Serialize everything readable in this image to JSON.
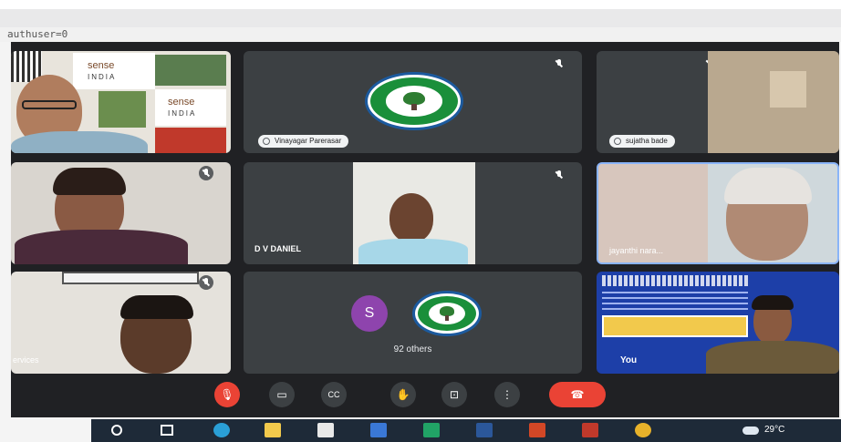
{
  "browser": {
    "url_fragment": "authuser=0"
  },
  "meeting": {
    "tiles": [
      {
        "id": "sense-india",
        "name": "",
        "banner_text": [
          "sense",
          "INDIA",
          "sense",
          "INDIA"
        ]
      },
      {
        "id": "vinayagar",
        "name": "Vinayagar Parerasar"
      },
      {
        "id": "sujatha",
        "name": "sujatha bade"
      },
      {
        "id": "woman-left",
        "name": ""
      },
      {
        "id": "dv-daniel",
        "name": "D V DANIEL"
      },
      {
        "id": "jayanthi",
        "name": "jayanthi nara..."
      },
      {
        "id": "services",
        "name": "ervices"
      },
      {
        "id": "others",
        "avatar_letter": "S",
        "others_label": "92 others"
      },
      {
        "id": "presentation",
        "name": "",
        "slide_text": "You"
      }
    ],
    "accent_colors": {
      "end_call": "#ea4335",
      "avatar_purple": "#8e44ad",
      "logo_green": "#1a8f3a",
      "logo_blue": "#1c5a9e"
    }
  },
  "controls": {
    "icons": [
      "mic-off-icon",
      "camera-icon",
      "captions-icon",
      "raise-hand-icon",
      "present-icon",
      "more-options-icon",
      "end-call-icon"
    ],
    "glyphs": {
      "mic": "🎙",
      "cam": "▭",
      "cc": "CC",
      "hand": "✋",
      "present": "⊡",
      "more": "⋮",
      "end": "☎"
    }
  },
  "taskbar": {
    "weather": "29°C"
  }
}
